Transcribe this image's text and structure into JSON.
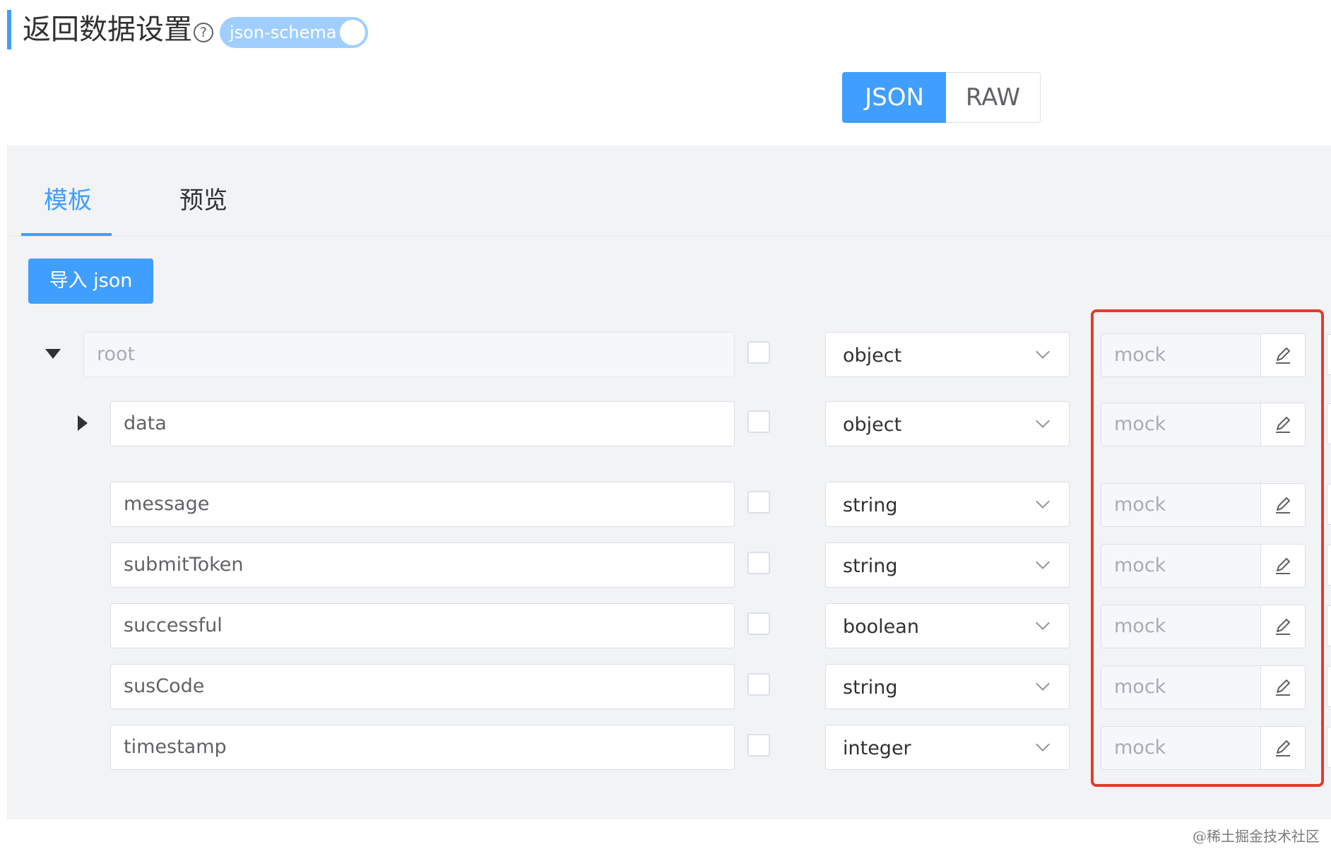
{
  "header": {
    "title": "返回数据设置",
    "help_glyph": "?",
    "schema_toggle": {
      "label": "json-schema",
      "on": true
    }
  },
  "format_switch": {
    "options": [
      "JSON",
      "RAW"
    ],
    "selected": "JSON"
  },
  "tabs": {
    "items": [
      "模板",
      "预览"
    ],
    "active": "模板"
  },
  "import_button": "导入 json",
  "rows": [
    {
      "name": "root",
      "type": "object",
      "mock": "mock",
      "expander": "expanded",
      "disabled": true
    },
    {
      "name": "data",
      "type": "object",
      "mock": "mock",
      "expander": "collapsed",
      "disabled": false
    },
    {
      "name": "message",
      "type": "string",
      "mock": "mock",
      "expander": "none",
      "disabled": false
    },
    {
      "name": "submitToken",
      "type": "string",
      "mock": "mock",
      "expander": "none",
      "disabled": false
    },
    {
      "name": "successful",
      "type": "boolean",
      "mock": "mock",
      "expander": "none",
      "disabled": false
    },
    {
      "name": "susCode",
      "type": "string",
      "mock": "mock",
      "expander": "none",
      "disabled": false
    },
    {
      "name": "timestamp",
      "type": "integer",
      "mock": "mock",
      "expander": "none",
      "disabled": false
    }
  ],
  "icons": {
    "edit": "edit-pencil-icon",
    "help": "question-circle-icon"
  },
  "colors": {
    "primary": "#409eff",
    "highlight_box": "#e53a2b"
  },
  "watermark": "@稀土掘金技术社区"
}
